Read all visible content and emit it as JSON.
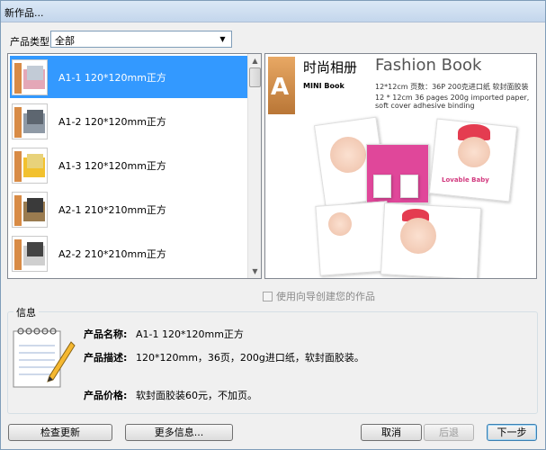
{
  "window": {
    "title": "新作品..."
  },
  "filter": {
    "label": "产品类型:",
    "value": "全部"
  },
  "products": [
    {
      "name": "A1-1  120*120mm正方"
    },
    {
      "name": "A1-2  120*120mm正方"
    },
    {
      "name": "A1-3  120*120mm正方"
    },
    {
      "name": "A2-1  210*210mm正方"
    },
    {
      "name": "A2-2  210*210mm正方"
    }
  ],
  "preview": {
    "letter": "A",
    "title_cn": "时尚相册",
    "title_en": "Fashion Book",
    "mini": "MINI Book",
    "spec_cn": "12*12cm   页数：36P   200克进口纸   软封面胶装",
    "spec_en": "12 * 12cm   36 pages 200g imported paper, soft cover adhesive binding",
    "badge": "Lovable Baby"
  },
  "wizard_checkbox": "使用向导创建您的作品",
  "info": {
    "legend": "信息",
    "name_label": "产品名称:",
    "name_value": "A1-1  120*120mm正方",
    "desc_label": "产品描述:",
    "desc_value": "120*120mm，36页，200g进口纸，软封面胶装。",
    "price_label": "产品价格:",
    "price_value": "软封面胶装60元，不加页。"
  },
  "buttons": {
    "check_update": "检查更新",
    "more_info": "更多信息...",
    "cancel": "取消",
    "back": "后退",
    "next": "下一步"
  }
}
